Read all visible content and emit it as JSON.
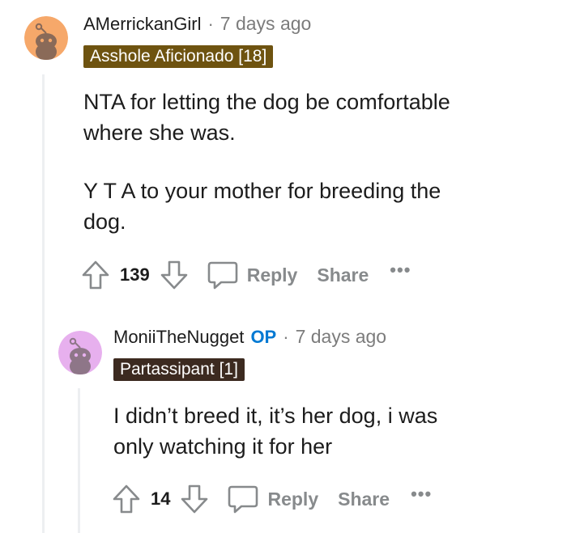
{
  "comments": [
    {
      "username": "AMerrickanGirl",
      "separator": "·",
      "time": "7 days ago",
      "flair": "Asshole Aficionado [18]",
      "flair_color": "#6e5310",
      "avatar_bg": "#f6a86a",
      "body": [
        "NTA for letting the dog be comfortable where she was.",
        "Y T A to your mother for breeding the dog."
      ],
      "score": "139",
      "reply_label": "Reply",
      "share_label": "Share",
      "more_label": "•••"
    },
    {
      "username": "MoniiTheNugget",
      "op_badge": "OP",
      "separator": "·",
      "time": "7 days ago",
      "flair": "Partassipant [1]",
      "flair_color": "#3c2a20",
      "avatar_bg": "#e7b0ee",
      "body": [
        "I didn’t breed it, it’s her dog, i was only watching it for her"
      ],
      "score": "14",
      "reply_label": "Reply",
      "share_label": "Share",
      "more_label": "•••"
    }
  ],
  "icons": {
    "upvote": "upvote-arrow-icon",
    "downvote": "downvote-arrow-icon",
    "reply": "comment-bubble-icon",
    "avatar": "snoo-avatar-icon"
  }
}
